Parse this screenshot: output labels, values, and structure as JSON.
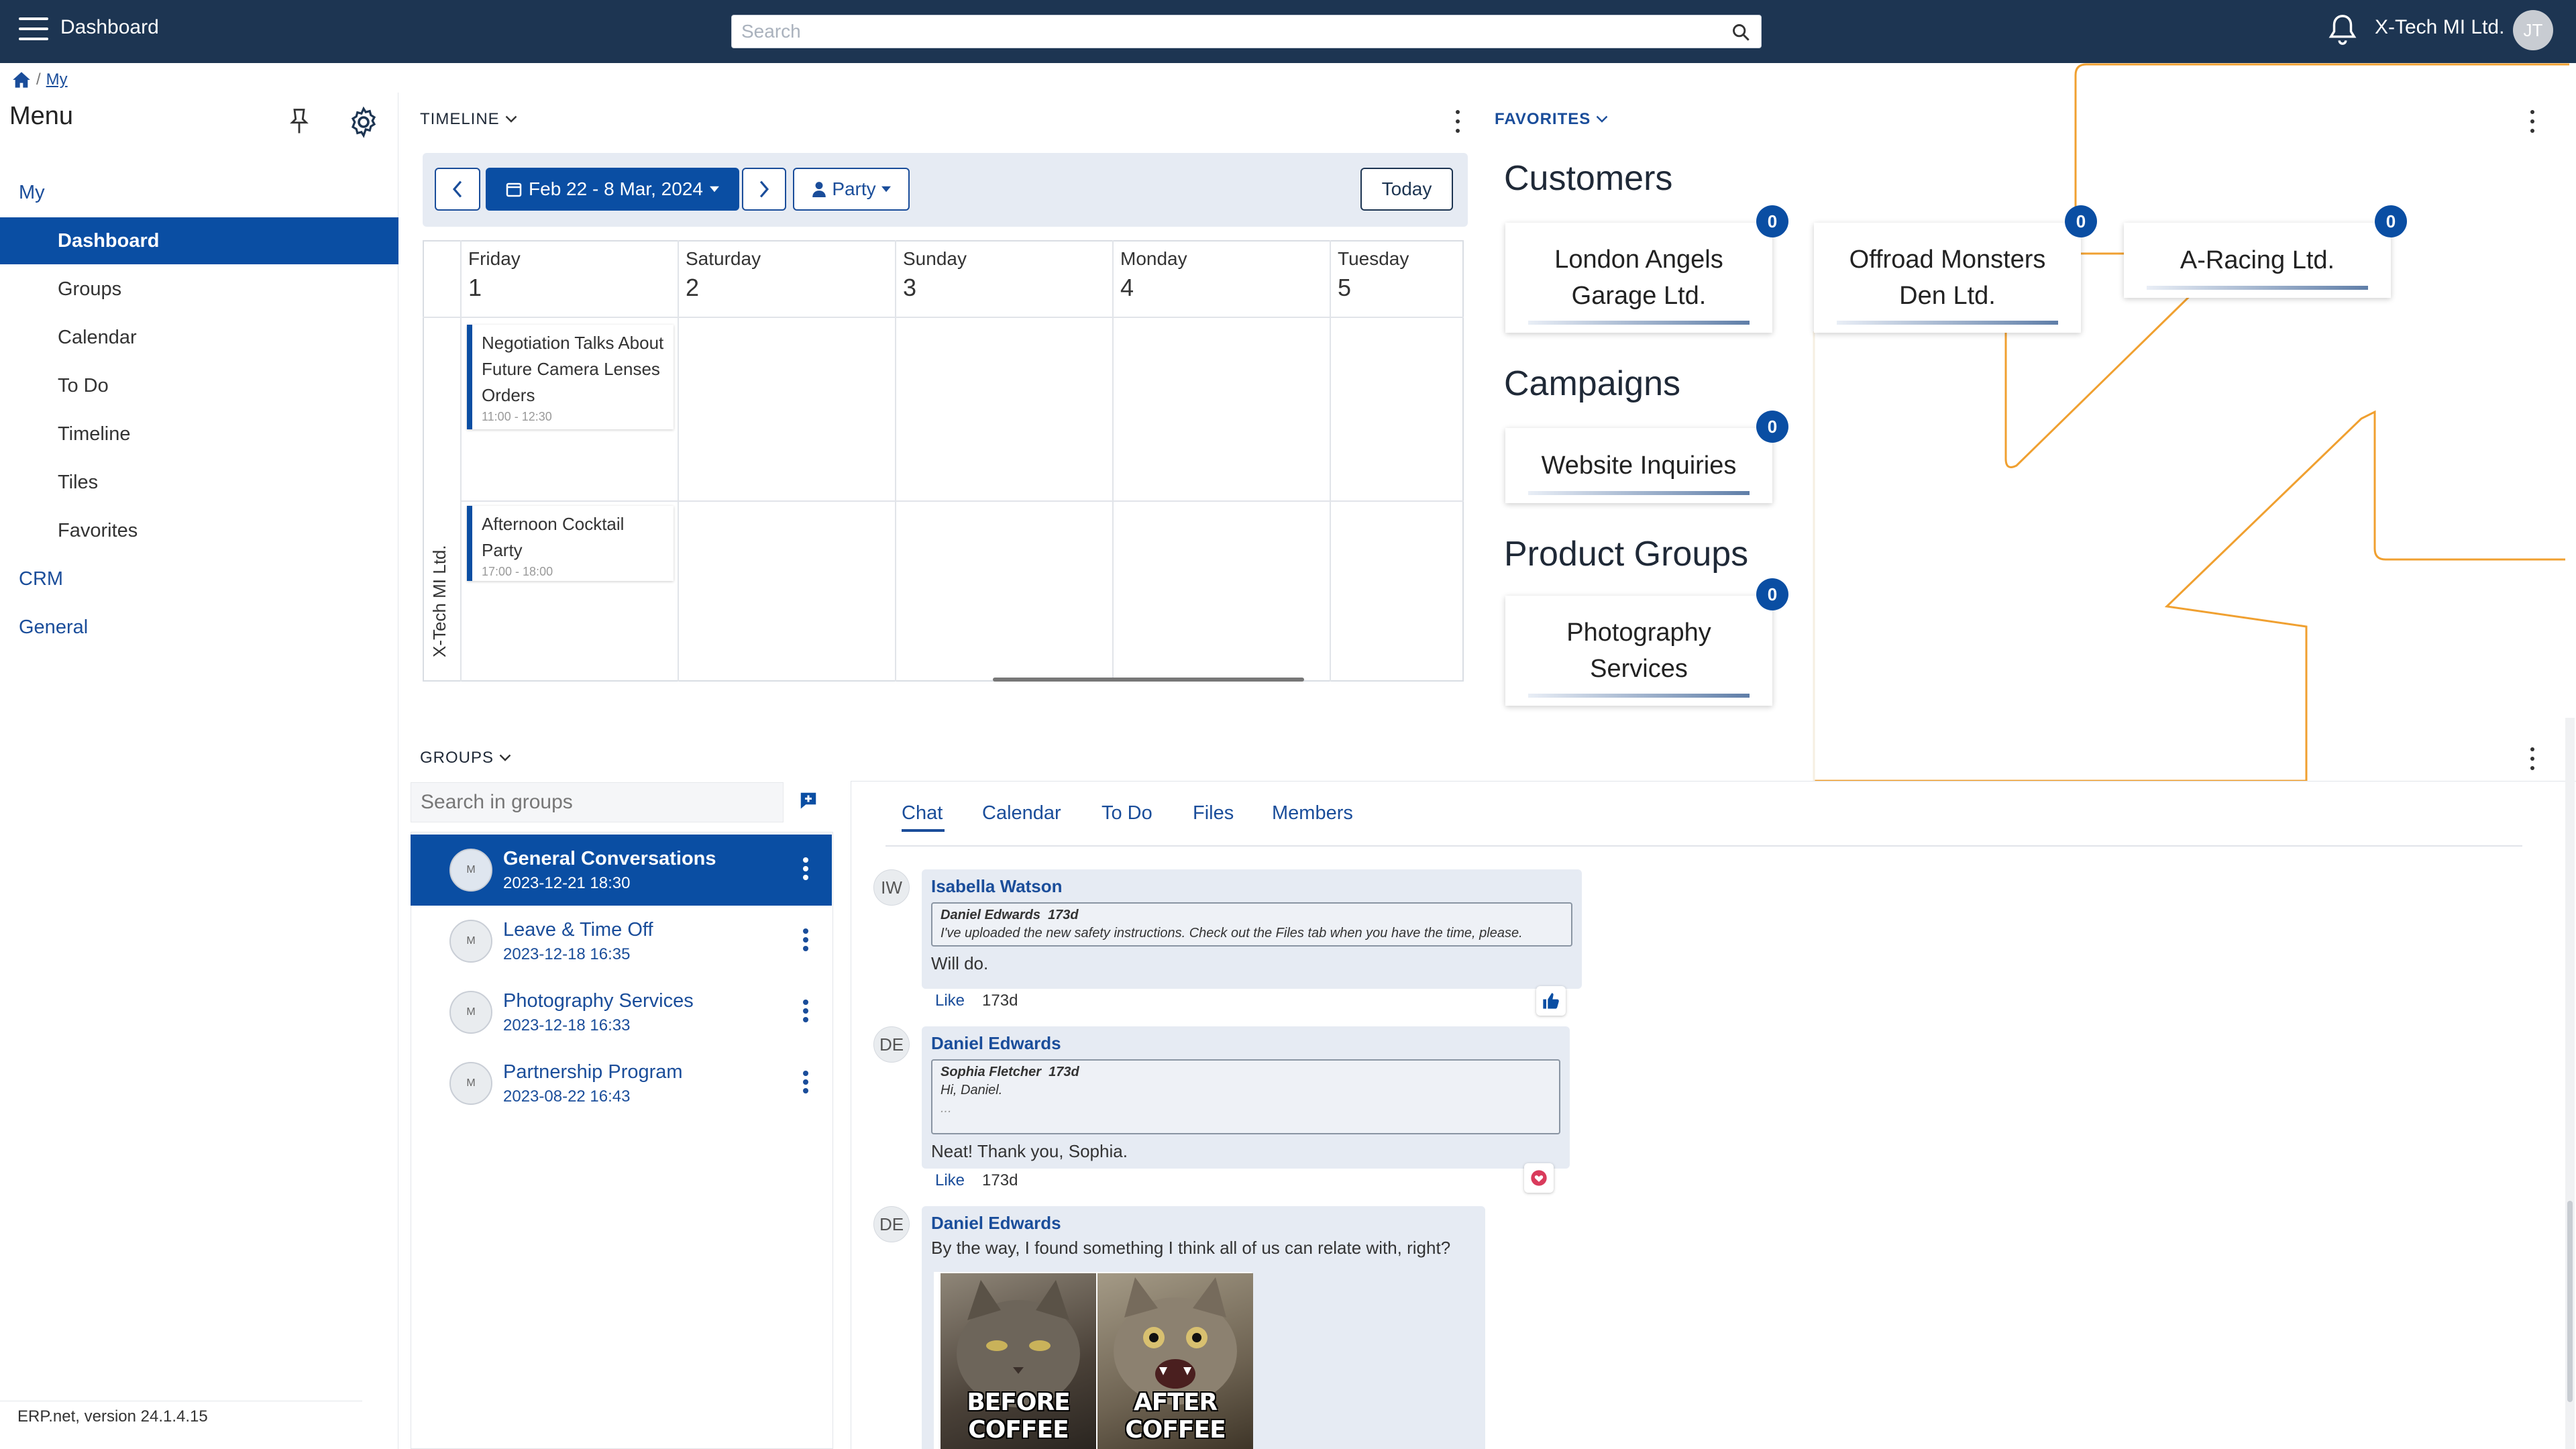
{
  "topbar": {
    "title": "Dashboard",
    "search_placeholder": "Search",
    "company": "X-Tech MI Ltd.",
    "avatar_initials": "JT"
  },
  "breadcrumb": {
    "current": "My"
  },
  "sidebar": {
    "title": "Menu",
    "items": [
      {
        "label": "My",
        "level": "top"
      },
      {
        "label": "Dashboard",
        "level": "sub",
        "active": true
      },
      {
        "label": "Groups",
        "level": "sub"
      },
      {
        "label": "Calendar",
        "level": "sub"
      },
      {
        "label": "To Do",
        "level": "sub"
      },
      {
        "label": "Timeline",
        "level": "sub"
      },
      {
        "label": "Tiles",
        "level": "sub"
      },
      {
        "label": "Favorites",
        "level": "sub"
      },
      {
        "label": "CRM",
        "level": "top"
      },
      {
        "label": "General",
        "level": "top"
      }
    ],
    "version": "ERP.net, version 24.1.4.15"
  },
  "timeline": {
    "header": "TIMELINE",
    "date_range": "Feb 22 - 8 Mar, 2024",
    "filter": "Party",
    "today": "Today",
    "days": [
      {
        "name": "Friday",
        "num": "1"
      },
      {
        "name": "Saturday",
        "num": "2"
      },
      {
        "name": "Sunday",
        "num": "3"
      },
      {
        "name": "Monday",
        "num": "4"
      },
      {
        "name": "Tuesday",
        "num": "5"
      }
    ],
    "row_label": "X-Tech MI Ltd.",
    "events": [
      {
        "title": "Negotiation Talks About Future Camera Lenses Orders",
        "time": "11:00 - 12:30"
      },
      {
        "title": "Afternoon Cocktail Party",
        "time": "17:00 - 18:00"
      }
    ]
  },
  "favorites": {
    "header": "FAVORITES",
    "customers_title": "Customers",
    "customers": [
      {
        "name": "London Angels Garage Ltd.",
        "count": "0"
      },
      {
        "name": "Offroad Monsters Den Ltd.",
        "count": "0"
      },
      {
        "name": "A-Racing Ltd.",
        "count": "0"
      }
    ],
    "campaigns_title": "Campaigns",
    "campaigns": [
      {
        "name": "Website Inquiries",
        "count": "0"
      }
    ],
    "product_groups_title": "Product Groups",
    "product_groups": [
      {
        "name": "Photography Services",
        "count": "0"
      }
    ]
  },
  "groups": {
    "header": "GROUPS",
    "search_placeholder": "Search in groups",
    "list": [
      {
        "name": "General Conversations",
        "date": "2023-12-21 18:30",
        "active": true
      },
      {
        "name": "Leave & Time Off",
        "date": "2023-12-18 16:35"
      },
      {
        "name": "Photography Services",
        "date": "2023-12-18 16:33"
      },
      {
        "name": "Partnership Program",
        "date": "2023-08-22 16:43"
      }
    ]
  },
  "chat": {
    "tabs": [
      "Chat",
      "Calendar",
      "To Do",
      "Files",
      "Members"
    ],
    "like_label": "Like",
    "messages": [
      {
        "initials": "IW",
        "author": "Isabella Watson",
        "quote_author": "Daniel Edwards",
        "quote_age": "173d",
        "quote_text": "I've uploaded the new safety instructions. Check out the Files tab when you have the time, please.",
        "text": "Will do.",
        "age": "173d",
        "reaction": "thumbs-up"
      },
      {
        "initials": "DE",
        "author": "Daniel Edwards",
        "quote_author": "Sophia Fletcher",
        "quote_age": "173d",
        "quote_text": "Hi, Daniel.",
        "quote_more": "...",
        "text": "Neat! Thank you, Sophia.",
        "age": "173d",
        "reaction": "heart"
      },
      {
        "initials": "DE",
        "author": "Daniel Edwards",
        "text": "By the way, I found something I think all of us can relate with, right?",
        "image_captions": [
          "BEFORE COFFEE",
          "AFTER COFFEE"
        ]
      }
    ]
  },
  "colors": {
    "topbar": "#1d3552",
    "accent": "#0a4ea3",
    "decor_line": "#f0a030"
  }
}
